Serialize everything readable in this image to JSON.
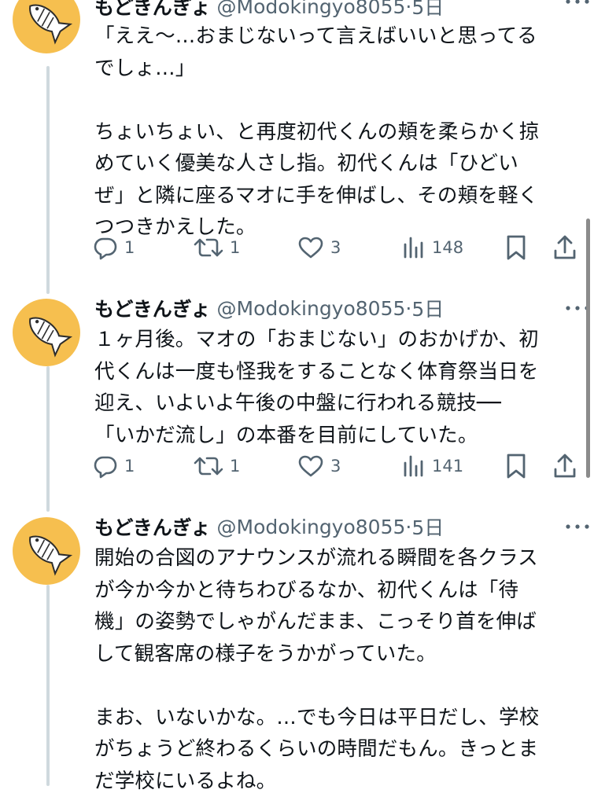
{
  "tweets": [
    {
      "name": "もどきんぎょ",
      "handle": "@Modokingyo8055",
      "time": "5日",
      "text": "「ええ〜…おまじないって言えばいいと思ってる\nでしょ…」\n\nちょいちょい、と再度初代くんの頬を柔らかく掠\nめていく優美な人さし指。初代くんは「ひどい\nぜ」と隣に座るマオに手を伸ばし、その頬を軽く\nつつきかえした。",
      "replies": "1",
      "retweets": "1",
      "likes": "3",
      "views": "148"
    },
    {
      "name": "もどきんぎょ",
      "handle": "@Modokingyo8055",
      "time": "5日",
      "text": "１ヶ月後。マオの「おまじない」のおかげか、初\n代くんは一度も怪我をすることなく体育祭当日を\n迎え、いよいよ午後の中盤に行われる競技──\n「いかだ流し」の本番を目前にしていた。",
      "replies": "1",
      "retweets": "1",
      "likes": "3",
      "views": "141"
    },
    {
      "name": "もどきんぎょ",
      "handle": "@Modokingyo8055",
      "time": "5日",
      "text": "開始の合図のアナウンスが流れる瞬間を各クラス\nが今か今かと待ちわびるなか、初代くんは「待\n機」の姿勢でしゃがんだまま、こっそり首を伸ば\nして観客席の様子をうかがっていた。\n\nまお、いないかな。…でも今日は平日だし、学校\nがちょうど終わるくらいの時間だもん。きっとま\nだ学校にいるよね。"
    }
  ],
  "separator": " · ",
  "icons": [
    "reply-icon",
    "retweet-icon",
    "like-icon",
    "views-icon",
    "bookmark-icon",
    "share-icon",
    "more-icon"
  ],
  "colors": {
    "avatar_bg": "#f6bf4f",
    "thread_line": "#cfd9de",
    "secondary_text": "#536471",
    "primary_text": "#0f1419"
  }
}
